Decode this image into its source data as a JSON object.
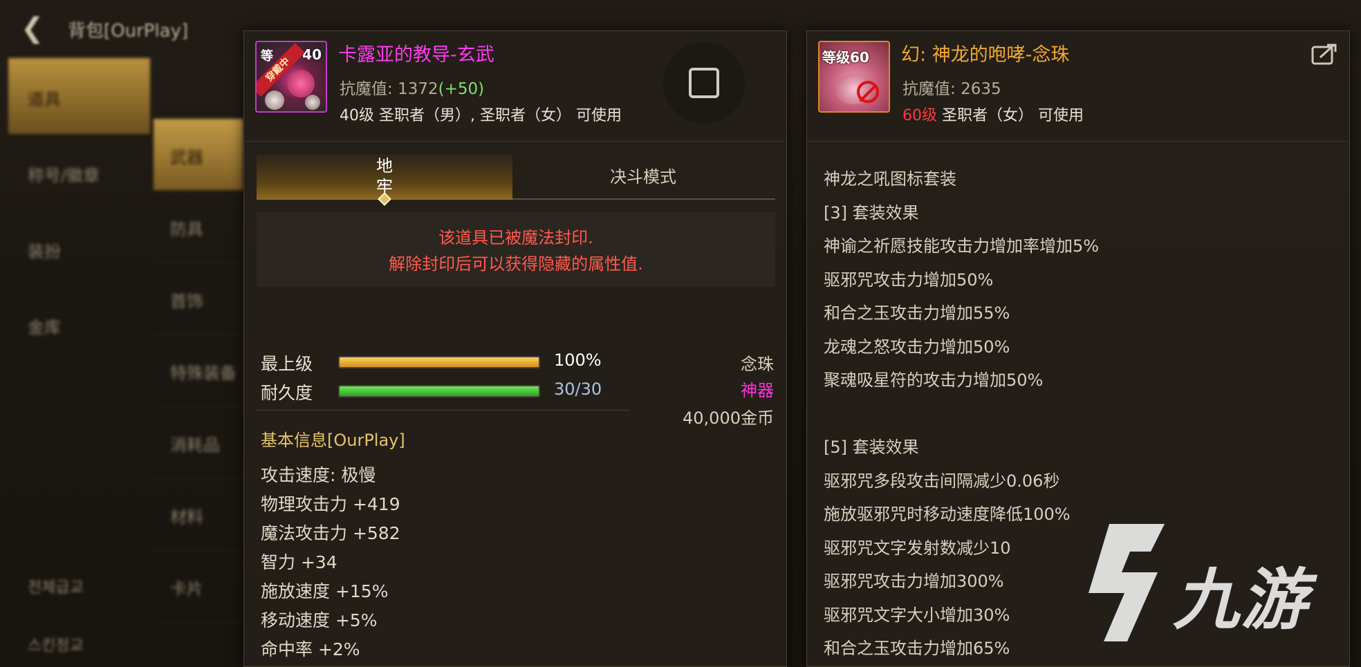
{
  "background": {
    "title": "背包[OurPlay]",
    "categories": [
      "道具",
      "称号/徽章",
      "装扮",
      "金库"
    ],
    "subcategories": [
      "武器",
      "防具",
      "首饰",
      "特殊装备",
      "消耗品",
      "材料",
      "卡片"
    ],
    "korean_items": [
      "전체급교",
      "스킨정교"
    ]
  },
  "left_item": {
    "icon": "bead-weapon-icon",
    "icon_level": "40",
    "icon_prefix": "等",
    "icon_ribbon": "穿戴中",
    "name": "卡露亚的教导-玄武",
    "name_color": "#ff3cf0",
    "magic_resist_label": "抗魔值: ",
    "magic_resist_value": "1372",
    "magic_resist_bonus": "(+50)",
    "usable": "40级 圣职者（男）, 圣职者（女） 可使用",
    "tabs": [
      "地牢",
      "决斗模式"
    ],
    "seal_notice": [
      "该道具已被魔法封印.",
      "解除封印后可以获得隐藏的属性值."
    ],
    "grade_label": "最上级",
    "grade_percent": 100,
    "grade_text": "100%",
    "durability_label": "耐久度",
    "durability_current": 30,
    "durability_max": 30,
    "durability_text": "30/30",
    "weapon_type": "念珠",
    "rarity": "神器",
    "rarity_color": "#ff30e0",
    "price": "40,000金币",
    "section_title": "基本信息[OurPlay]",
    "stats": [
      "攻击速度: 极慢",
      "物理攻击力 +419",
      "魔法攻击力 +582",
      "智力 +34",
      "施放速度 +15%",
      "移动速度 +5%",
      "命中率 +2%"
    ]
  },
  "right_item": {
    "icon": "dragon-bead-icon",
    "icon_level": "等级60",
    "name": "幻: 神龙的咆哮-念珠",
    "name_color": "#f2a832",
    "magic_resist_label": "抗魔值: ",
    "magic_resist_value": "2635",
    "usable_level": "60级",
    "usable_rest": " 圣职者（女） 可使用",
    "set_lines": [
      "神龙之吼图标套装",
      "[3] 套装效果",
      "神谕之祈愿技能攻击力增加率增加5%",
      "驱邪咒攻击力增加50%",
      "和合之玉攻击力增加55%",
      "龙魂之怒攻击力增加50%",
      "聚魂吸星符的攻击力增加50%",
      "",
      "[5] 套装效果",
      "驱邪咒多段攻击间隔减少0.06秒",
      "施放驱邪咒时移动速度降低100%",
      "驱邪咒文字发射数减少10",
      "驱邪咒攻击力增加300%",
      "驱邪咒文字大小增加30%",
      "和合之玉攻击力增加65%"
    ]
  },
  "watermark": {
    "text": "九游"
  }
}
